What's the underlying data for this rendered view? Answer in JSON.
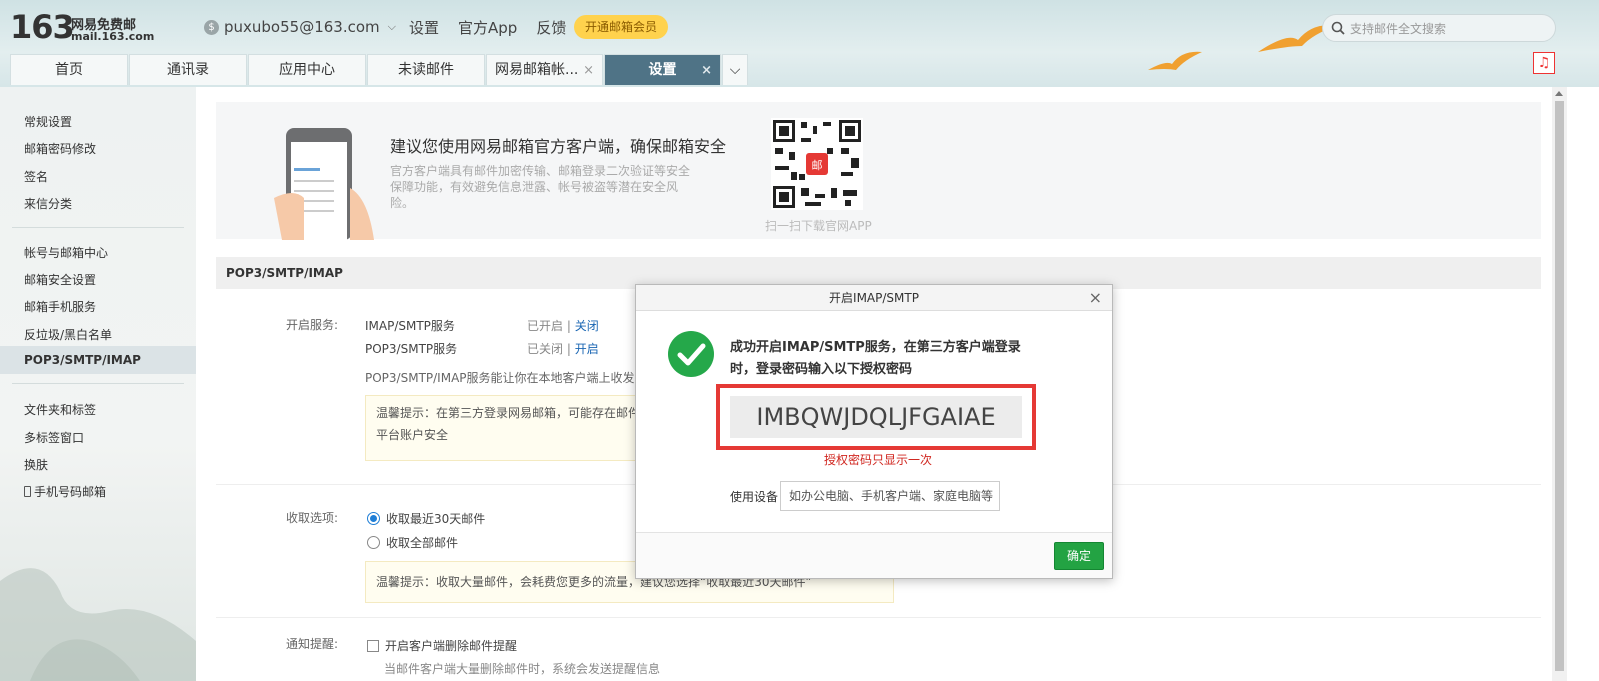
{
  "logo": {
    "number": "163",
    "name": "网易免费邮",
    "domain": "mail.163.com"
  },
  "account": {
    "email": "puxubo55@163.com"
  },
  "top_links": [
    "设置",
    "官方App",
    "反馈"
  ],
  "vip_button": "开通邮箱会员",
  "search": {
    "placeholder": "支持邮件全文搜索"
  },
  "tabs": [
    {
      "label": "首页"
    },
    {
      "label": "通讯录"
    },
    {
      "label": "应用中心"
    },
    {
      "label": "未读邮件"
    },
    {
      "label": "网易邮箱帐...",
      "closable": true
    },
    {
      "label": "设置",
      "closable": true,
      "active": true
    }
  ],
  "tab_close": "×",
  "sidebar": {
    "group1": [
      "常规设置",
      "邮箱密码修改",
      "签名",
      "来信分类"
    ],
    "group2": [
      "帐号与邮箱中心",
      "邮箱安全设置",
      "邮箱手机服务",
      "反垃圾/黑白名单",
      "POP3/SMTP/IMAP"
    ],
    "group3": [
      "文件夹和标签",
      "多标签窗口",
      "换肤",
      "手机号码邮箱"
    ],
    "active": "POP3/SMTP/IMAP"
  },
  "banner": {
    "title": "建议您使用网易邮箱官方客户端，确保邮箱安全",
    "text": "官方客户端具有邮件加密传输、邮箱登录二次验证等安全保障功能，有效避免信息泄露、帐号被盗等潜在安全风险。",
    "qr_caption": "扫一扫下载官网APP"
  },
  "section": {
    "title": "POP3/SMTP/IMAP",
    "service_label": "开启服务:",
    "services": [
      {
        "name": "IMAP/SMTP服务",
        "status": "已开启",
        "action": "关闭"
      },
      {
        "name": "POP3/SMTP服务",
        "status": "已关闭",
        "action": "开启"
      }
    ],
    "service_note": "POP3/SMTP/IMAP服务能让你在本地客户端上收发",
    "tip1": "温馨提示：在第三方登录网易邮箱，可能存在邮件",
    "tip1_line2": "平台账户安全",
    "receive_label": "收取选项:",
    "receive_options": [
      "收取最近30天邮件",
      "收取全部邮件"
    ],
    "tip2": "温馨提示：收取大量邮件，会耗费您更多的流量，建议您选择“收取最近30天邮件”",
    "notify_label": "通知提醒:",
    "notify_option": "开启客户端删除邮件提醒",
    "notify_note": "当邮件客户端大量删除邮件时，系统会发送提醒信息"
  },
  "dialog": {
    "title": "开启IMAP/SMTP",
    "close": "×",
    "message": "成功开启IMAP/SMTP服务，在第三方客户端登录时，登录密码输入以下授权密码",
    "auth_code": "IMBQWJDQLJFGAIAE",
    "code_note": "授权密码只显示一次",
    "device_label": "使用设备",
    "device_placeholder": "如办公电脑、手机客户端、家庭电脑等",
    "ok": "确定"
  },
  "colors": {
    "accent_tab": "#4f7386",
    "ok_green": "#23a343",
    "highlight_red": "#e53935",
    "link": "#1a66b3"
  }
}
